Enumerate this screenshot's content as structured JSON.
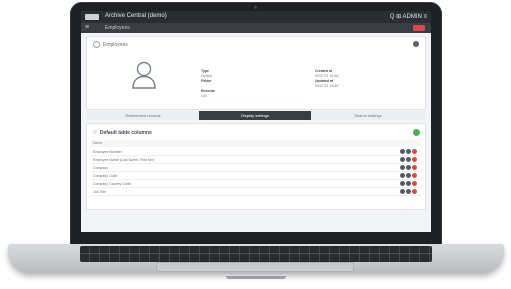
{
  "app": {
    "title": "Archive Central (demo)",
    "top_right": "Q  ⊞  ADMIN  ≡"
  },
  "subbar": {
    "breadcrumb": "Employees"
  },
  "card": {
    "heading": "Employees",
    "fields": [
      {
        "label": "Type",
        "value": "Default"
      },
      {
        "label": "Folder",
        "value": "-"
      },
      {
        "label": "Records",
        "value": "100"
      },
      {
        "label": "Created at",
        "value": "09/07/21 16:46"
      },
      {
        "label": "Updated at",
        "value": "09/07/21 16:46"
      }
    ]
  },
  "tabs": [
    {
      "label": "Referenced records",
      "active": false
    },
    {
      "label": "Display settings",
      "active": true
    },
    {
      "label": "Search settings",
      "active": false
    }
  ],
  "panel": {
    "title": "Default table columns",
    "column_header": "Name",
    "rows": [
      "Employee Number",
      "Employee Name (Last Name, First Nm)",
      "Company",
      "Company Code",
      "Company Country Code",
      "Job Title"
    ]
  },
  "colors": {
    "topbar": "#2b2d33",
    "accent_red": "#d94a4a",
    "accent_green": "#4caf50"
  },
  "icons": [
    "menu-icon",
    "user-avatar-icon",
    "gear-icon",
    "filter-icon",
    "add-icon",
    "move-up-icon",
    "move-down-icon",
    "remove-icon"
  ]
}
